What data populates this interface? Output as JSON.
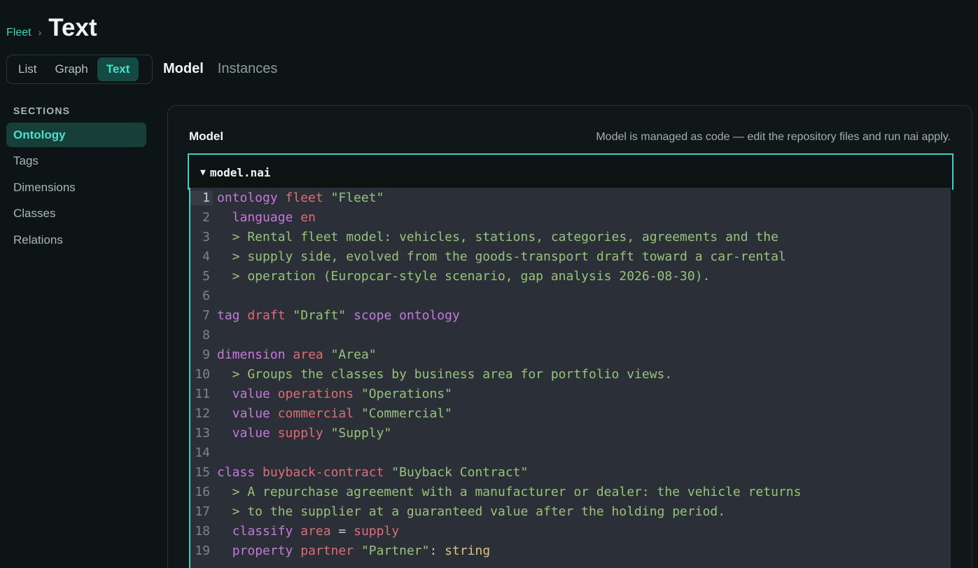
{
  "breadcrumb": {
    "parent": "Fleet",
    "separator": "›"
  },
  "page_title": "Text",
  "view_tabs": [
    {
      "label": "List",
      "active": false
    },
    {
      "label": "Graph",
      "active": false
    },
    {
      "label": "Text",
      "active": true
    }
  ],
  "sub_tabs": [
    {
      "label": "Model",
      "active": true
    },
    {
      "label": "Instances",
      "active": false
    }
  ],
  "sidebar": {
    "heading": "SECTIONS",
    "items": [
      {
        "label": "Ontology",
        "active": true
      },
      {
        "label": "Tags",
        "active": false
      },
      {
        "label": "Dimensions",
        "active": false
      },
      {
        "label": "Classes",
        "active": false
      },
      {
        "label": "Relations",
        "active": false
      }
    ]
  },
  "panel": {
    "title": "Model",
    "note": "Model is managed as code — edit the repository files and run nai apply."
  },
  "file": {
    "toggle_icon": "▼",
    "name": "model.nai"
  },
  "colors": {
    "accent": "#3fd1bd",
    "keyword": "#c678dd",
    "name": "#e06c75",
    "string": "#98c379",
    "type": "#e5c07b"
  },
  "code_lines": [
    {
      "n": "1",
      "tokens": [
        {
          "t": "kw",
          "v": "ontology"
        },
        {
          "t": "pl",
          "v": " "
        },
        {
          "t": "nm",
          "v": "fleet"
        },
        {
          "t": "pl",
          "v": " "
        },
        {
          "t": "st",
          "v": "\"Fleet\""
        }
      ]
    },
    {
      "n": "2",
      "tokens": [
        {
          "t": "pl",
          "v": "  "
        },
        {
          "t": "kw",
          "v": "language"
        },
        {
          "t": "pl",
          "v": " "
        },
        {
          "t": "nm",
          "v": "en"
        }
      ]
    },
    {
      "n": "3",
      "tokens": [
        {
          "t": "st",
          "v": "  > Rental fleet model: vehicles, stations, categories, agreements and the"
        }
      ]
    },
    {
      "n": "4",
      "tokens": [
        {
          "t": "st",
          "v": "  > supply side, evolved from the goods-transport draft toward a car-rental"
        }
      ]
    },
    {
      "n": "5",
      "tokens": [
        {
          "t": "st",
          "v": "  > operation (Europcar-style scenario, gap analysis 2026-08-30)."
        }
      ]
    },
    {
      "n": "6",
      "tokens": []
    },
    {
      "n": "7",
      "tokens": [
        {
          "t": "kw",
          "v": "tag"
        },
        {
          "t": "pl",
          "v": " "
        },
        {
          "t": "nm",
          "v": "draft"
        },
        {
          "t": "pl",
          "v": " "
        },
        {
          "t": "st",
          "v": "\"Draft\""
        },
        {
          "t": "pl",
          "v": " "
        },
        {
          "t": "kw",
          "v": "scope"
        },
        {
          "t": "pl",
          "v": " "
        },
        {
          "t": "kw",
          "v": "ontology"
        }
      ]
    },
    {
      "n": "8",
      "tokens": []
    },
    {
      "n": "9",
      "tokens": [
        {
          "t": "kw",
          "v": "dimension"
        },
        {
          "t": "pl",
          "v": " "
        },
        {
          "t": "nm",
          "v": "area"
        },
        {
          "t": "pl",
          "v": " "
        },
        {
          "t": "st",
          "v": "\"Area\""
        }
      ]
    },
    {
      "n": "10",
      "tokens": [
        {
          "t": "st",
          "v": "  > Groups the classes by business area for portfolio views."
        }
      ]
    },
    {
      "n": "11",
      "tokens": [
        {
          "t": "pl",
          "v": "  "
        },
        {
          "t": "kw",
          "v": "value"
        },
        {
          "t": "pl",
          "v": " "
        },
        {
          "t": "nm",
          "v": "operations"
        },
        {
          "t": "pl",
          "v": " "
        },
        {
          "t": "st",
          "v": "\"Operations\""
        }
      ]
    },
    {
      "n": "12",
      "tokens": [
        {
          "t": "pl",
          "v": "  "
        },
        {
          "t": "kw",
          "v": "value"
        },
        {
          "t": "pl",
          "v": " "
        },
        {
          "t": "nm",
          "v": "commercial"
        },
        {
          "t": "pl",
          "v": " "
        },
        {
          "t": "st",
          "v": "\"Commercial\""
        }
      ]
    },
    {
      "n": "13",
      "tokens": [
        {
          "t": "pl",
          "v": "  "
        },
        {
          "t": "kw",
          "v": "value"
        },
        {
          "t": "pl",
          "v": " "
        },
        {
          "t": "nm",
          "v": "supply"
        },
        {
          "t": "pl",
          "v": " "
        },
        {
          "t": "st",
          "v": "\"Supply\""
        }
      ]
    },
    {
      "n": "14",
      "tokens": []
    },
    {
      "n": "15",
      "tokens": [
        {
          "t": "kw",
          "v": "class"
        },
        {
          "t": "pl",
          "v": " "
        },
        {
          "t": "nm",
          "v": "buyback-contract"
        },
        {
          "t": "pl",
          "v": " "
        },
        {
          "t": "st",
          "v": "\"Buyback Contract\""
        }
      ]
    },
    {
      "n": "16",
      "tokens": [
        {
          "t": "st",
          "v": "  > A repurchase agreement with a manufacturer or dealer: the vehicle returns"
        }
      ]
    },
    {
      "n": "17",
      "tokens": [
        {
          "t": "st",
          "v": "  > to the supplier at a guaranteed value after the holding period."
        }
      ]
    },
    {
      "n": "18",
      "tokens": [
        {
          "t": "pl",
          "v": "  "
        },
        {
          "t": "kw",
          "v": "classify"
        },
        {
          "t": "pl",
          "v": " "
        },
        {
          "t": "nm",
          "v": "area"
        },
        {
          "t": "pl",
          "v": " = "
        },
        {
          "t": "nm",
          "v": "supply"
        }
      ]
    },
    {
      "n": "19",
      "tokens": [
        {
          "t": "pl",
          "v": "  "
        },
        {
          "t": "kw",
          "v": "property"
        },
        {
          "t": "pl",
          "v": " "
        },
        {
          "t": "nm",
          "v": "partner"
        },
        {
          "t": "pl",
          "v": " "
        },
        {
          "t": "st",
          "v": "\"Partner\""
        },
        {
          "t": "pl",
          "v": ": "
        },
        {
          "t": "ty",
          "v": "string"
        }
      ]
    }
  ]
}
